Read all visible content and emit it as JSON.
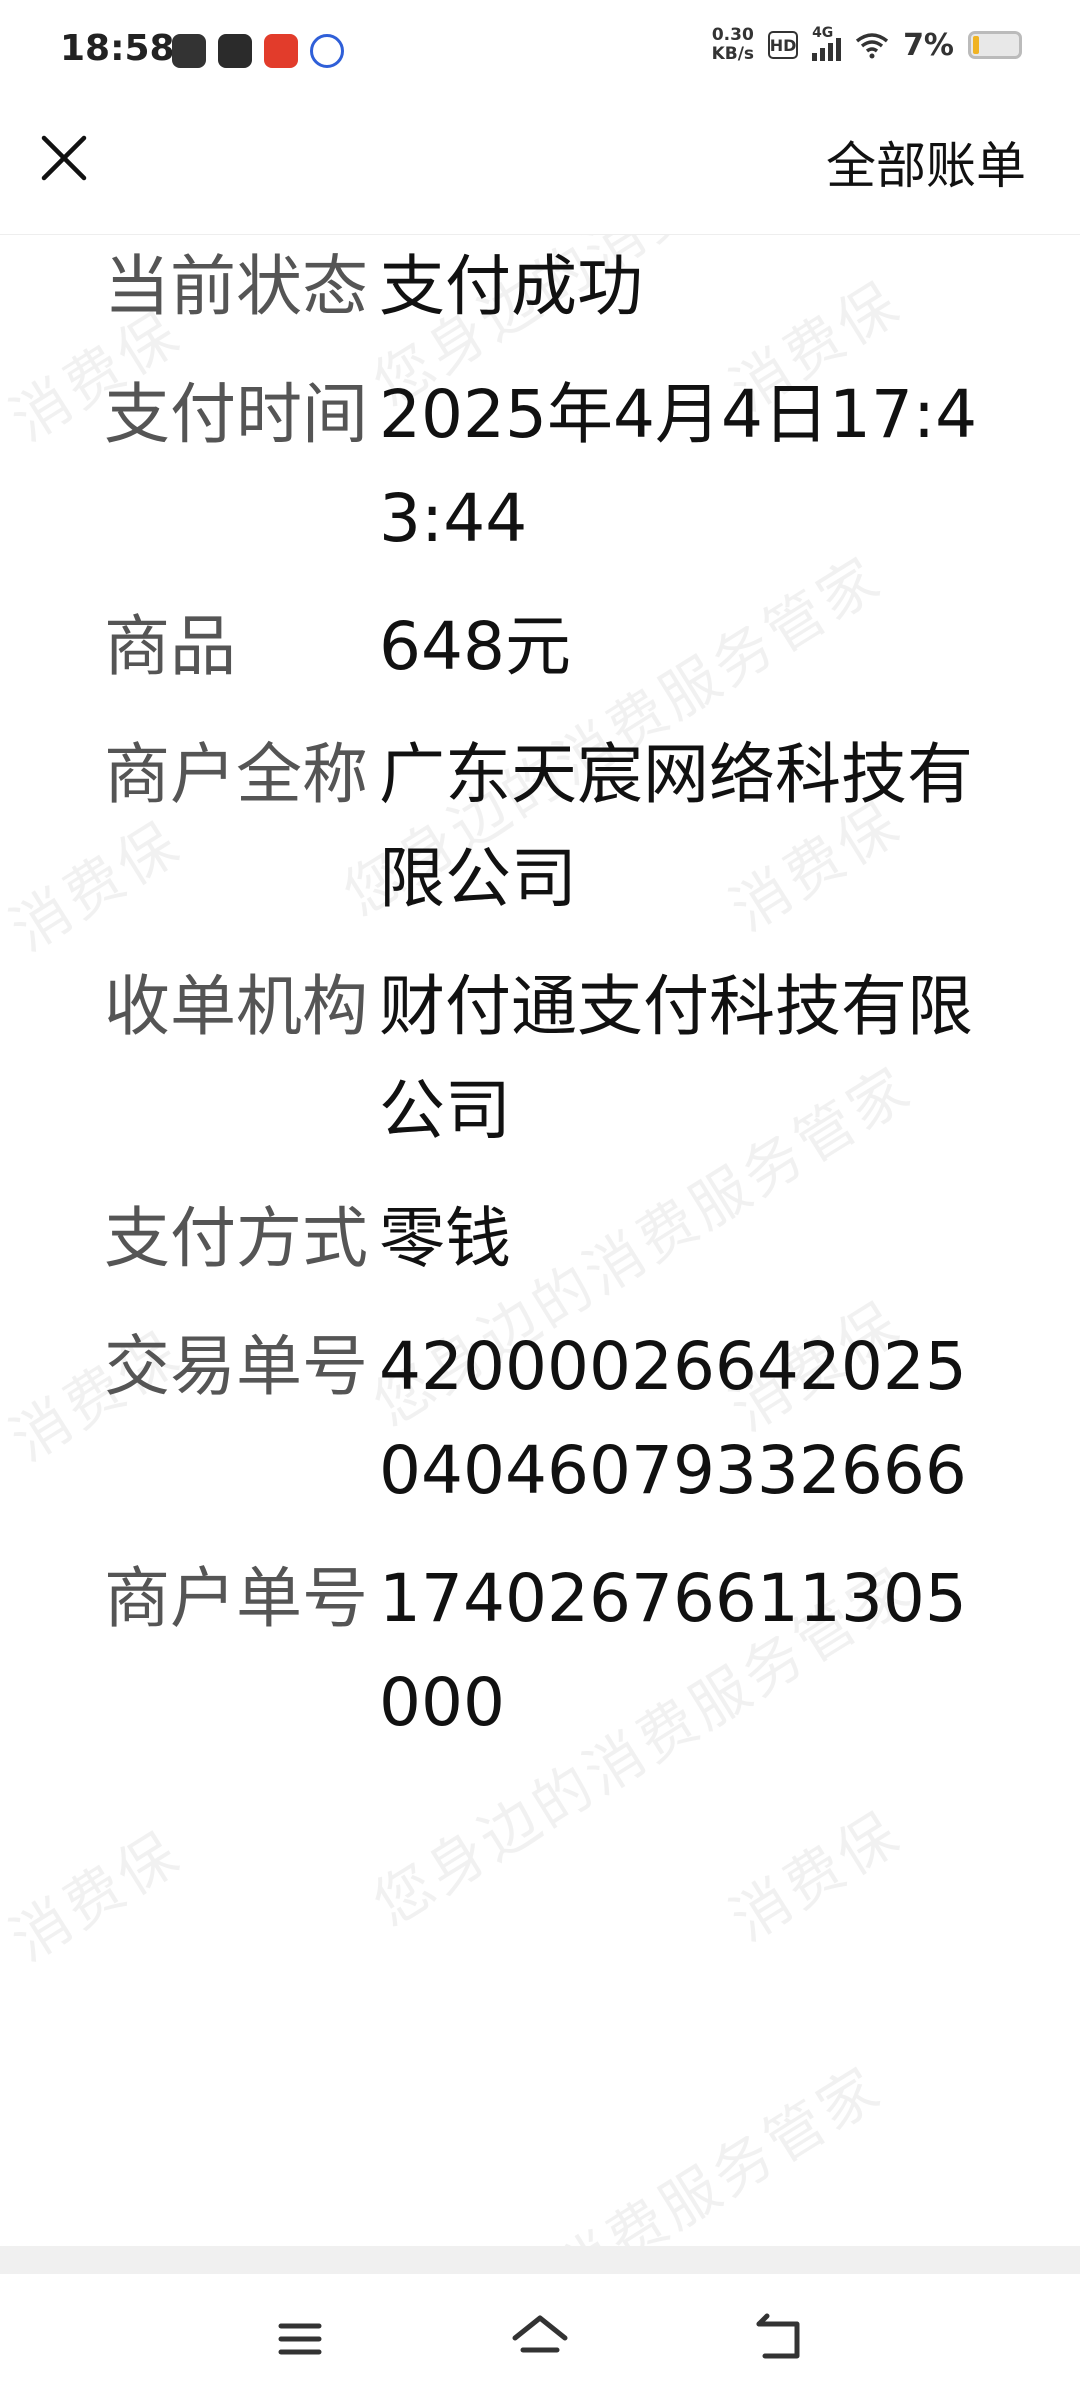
{
  "status_bar": {
    "time": "18:58",
    "net_speed_value": "0.30",
    "net_speed_unit": "KB/s",
    "hd": "HD",
    "network": "4G",
    "battery": "7%",
    "battery_level_percent": 7,
    "notification_icons": [
      "app-icon",
      "message-icon",
      "shopping-app-icon",
      "paw-app-icon"
    ]
  },
  "header": {
    "close_icon": "close-icon",
    "all_bills_label": "全部账单"
  },
  "details": [
    {
      "label": "当前状态",
      "value": "支付成功"
    },
    {
      "label": "支付时间",
      "value": "2025年4月4日17:43:44"
    },
    {
      "label": "商品",
      "value": "648元"
    },
    {
      "label": "商户全称",
      "value": "广东天宸网络科技有限公司"
    },
    {
      "label": "收单机构",
      "value": "财付通支付科技有限公司"
    },
    {
      "label": "支付方式",
      "value": "零钱"
    },
    {
      "label": "交易单号",
      "value": "4200002664202504046079332666"
    },
    {
      "label": "商户单号",
      "value": "17402676611305000"
    }
  ],
  "watermark_text": "您身边的消费服务管家",
  "watermark_text_short": "消费保",
  "nav_bar": {
    "icons": [
      "menu-icon",
      "home-icon",
      "back-icon"
    ]
  }
}
